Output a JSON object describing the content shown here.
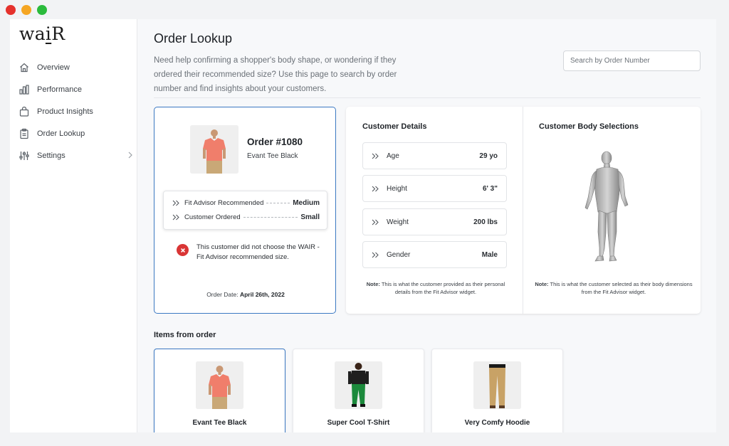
{
  "window": {
    "dot_colors": [
      "#e5322d",
      "#f5a623",
      "#2bbb3c"
    ]
  },
  "brand": {
    "logo_prefix": "wa",
    "logo_underlined": "i",
    "logo_suffix": "R"
  },
  "sidebar": {
    "items": [
      {
        "label": "Overview",
        "icon": "home-icon"
      },
      {
        "label": "Performance",
        "icon": "bar-chart-icon"
      },
      {
        "label": "Product Insights",
        "icon": "bag-icon"
      },
      {
        "label": "Order Lookup",
        "icon": "clipboard-icon"
      },
      {
        "label": "Settings",
        "icon": "sliders-icon"
      }
    ]
  },
  "header": {
    "title": "Order Lookup",
    "description": "Need help confirming a shopper's body shape, or wondering if they ordered their recommended size? Use this page to search by order number and find insights about your customers.",
    "search_placeholder": "Search by Order Number"
  },
  "order": {
    "number": "Order #1080",
    "product": "Evant Tee Black",
    "fit_rows": [
      {
        "label": "Fit Advisor Recommended",
        "value": "Medium"
      },
      {
        "label": "Customer Ordered",
        "value": "Small"
      }
    ],
    "warning": "This customer did not choose the WAIR - Fit Advisor recommended size.",
    "date_label": "Order Date:",
    "date_value": "April 26th, 2022"
  },
  "customer_details": {
    "title": "Customer Details",
    "rows": [
      {
        "label": "Age",
        "value": "29 yo"
      },
      {
        "label": "Height",
        "value": "6' 3\""
      },
      {
        "label": "Weight",
        "value": "200 lbs"
      },
      {
        "label": "Gender",
        "value": "Male"
      }
    ],
    "note_label": "Note:",
    "note_text": "This is what the customer provided as their personal details from the Fit Advisor widget."
  },
  "body_selections": {
    "title": "Customer Body Selections",
    "note_label": "Note:",
    "note_text": "This is what the customer selected as their body dimensions from the Fit Advisor widget."
  },
  "items": {
    "title": "Items from order",
    "list": [
      {
        "name": "Evant Tee Black",
        "selected": true
      },
      {
        "name": "Super Cool T-Shirt",
        "selected": false
      },
      {
        "name": "Very Comfy Hoodie",
        "selected": false
      }
    ]
  },
  "colors": {
    "accent": "#3b78c2",
    "danger": "#d93535",
    "shirt_coral": "#f07e6b",
    "pants_green": "#1c8a3c",
    "chino_khaki": "#c8a266"
  }
}
